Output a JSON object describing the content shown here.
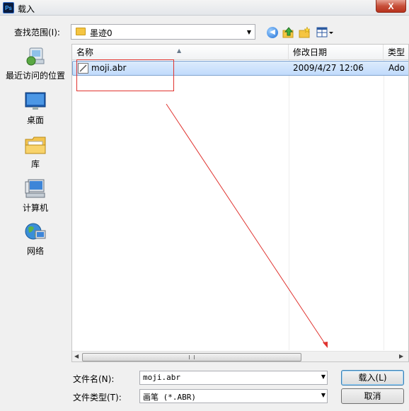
{
  "window": {
    "app_icon_text": "Ps",
    "title": "载入",
    "close_label": "X"
  },
  "lookin": {
    "label": "查找范围(I):",
    "value": "墨迹0"
  },
  "places": [
    {
      "label": "最近访问的位置",
      "icon": "recent-places-icon"
    },
    {
      "label": "桌面",
      "icon": "desktop-icon"
    },
    {
      "label": "库",
      "icon": "libraries-icon"
    },
    {
      "label": "计算机",
      "icon": "computer-icon"
    },
    {
      "label": "网络",
      "icon": "network-icon"
    }
  ],
  "columns": [
    "名称",
    "修改日期",
    "类型"
  ],
  "files": [
    {
      "name": "moji.abr",
      "date": "2009/4/27 12:06",
      "type": "Ado"
    }
  ],
  "filename": {
    "label": "文件名(N):",
    "value": "moji.abr"
  },
  "filetype": {
    "label": "文件类型(T):",
    "value": "画笔 (*.ABR)"
  },
  "buttons": {
    "load": "载入(L)",
    "cancel": "取消"
  },
  "colors": {
    "annotation": "#e0332f",
    "selection": "#c1dbfc"
  }
}
